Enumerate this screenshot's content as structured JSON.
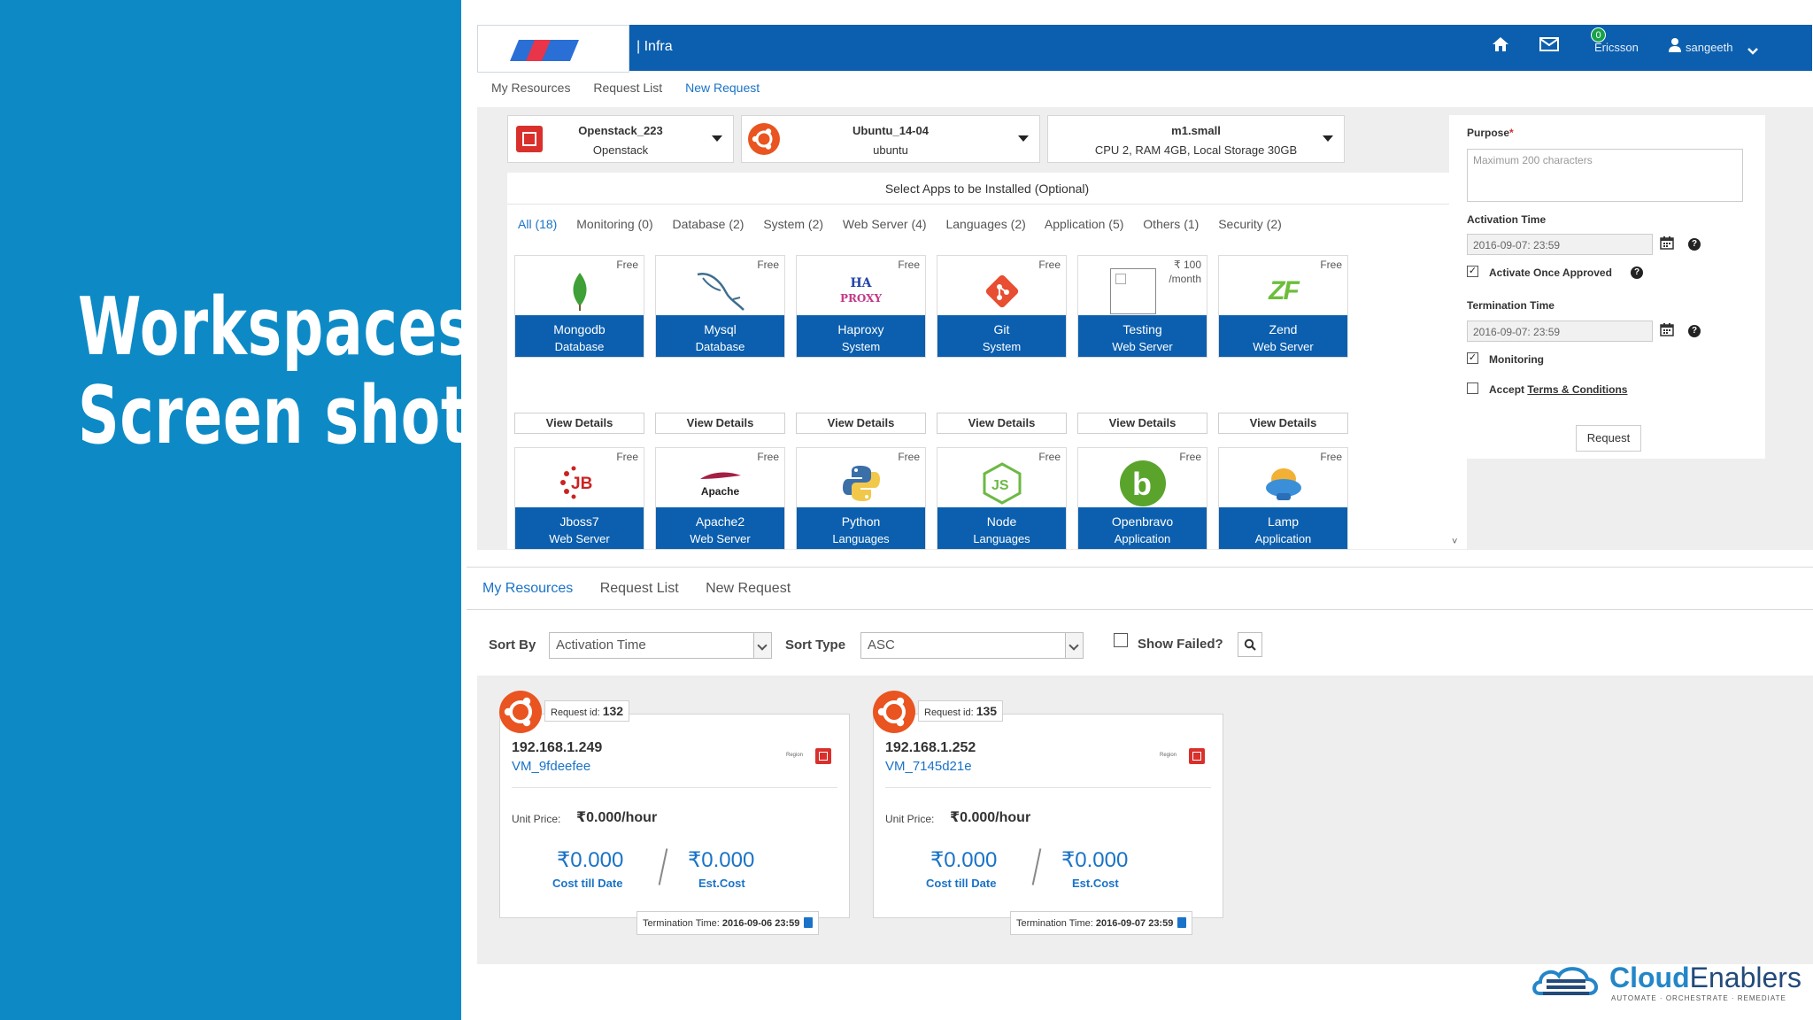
{
  "slide": {
    "title_line1": "Workspaces",
    "title_line2": "Screen shot"
  },
  "app_header": {
    "crumb": "| Infra",
    "mail_count": "0",
    "org": "Ericsson",
    "user": "sangeeth"
  },
  "subnav": [
    "My Resources",
    "Request List",
    "New Request"
  ],
  "selectors": [
    {
      "title": "Openstack_223",
      "sub": "Openstack"
    },
    {
      "title": "Ubuntu_14-04",
      "sub": "ubuntu"
    },
    {
      "title": "m1.small",
      "sub": "CPU 2, RAM 4GB, Local Storage 30GB"
    }
  ],
  "apps_header": "Select Apps to be Installed (Optional)",
  "filters": [
    "All (18)",
    "Monitoring (0)",
    "Database (2)",
    "System (2)",
    "Web Server (4)",
    "Languages (2)",
    "Application (5)",
    "Others (1)",
    "Security (2)"
  ],
  "apps": [
    {
      "name": "Mongodb",
      "cat": "Database",
      "price": "Free",
      "icon": "mongodb-leaf-icon"
    },
    {
      "name": "Mysql",
      "cat": "Database",
      "price": "Free",
      "icon": "mysql-dolphin-icon"
    },
    {
      "name": "Haproxy",
      "cat": "System",
      "price": "Free",
      "icon": "haproxy-logo-icon",
      "logo_text_1": "HA",
      "logo_text_2": "PROXY"
    },
    {
      "name": "Git",
      "cat": "System",
      "price": "Free",
      "icon": "git-logo-icon"
    },
    {
      "name": "Testing",
      "cat": "Web Server",
      "price": "₹ 100",
      "price2": "/month",
      "icon": "broken-image-icon"
    },
    {
      "name": "Zend",
      "cat": "Web Server",
      "price": "Free",
      "icon": "zend-logo-icon",
      "logo_text": "ZF"
    },
    {
      "name": "Jboss7",
      "cat": "Web Server",
      "price": "Free",
      "icon": "jboss-logo-icon",
      "logo_text": "JB"
    },
    {
      "name": "Apache2",
      "cat": "Web Server",
      "price": "Free",
      "icon": "apache-feather-icon",
      "logo_text": "Apache"
    },
    {
      "name": "Python",
      "cat": "Languages",
      "price": "Free",
      "icon": "python-logo-icon"
    },
    {
      "name": "Node",
      "cat": "Languages",
      "price": "Free",
      "icon": "nodejs-logo-icon",
      "logo_text": "JS"
    },
    {
      "name": "Openbravo",
      "cat": "Application",
      "price": "Free",
      "icon": "openbravo-logo-icon",
      "logo_text": "b"
    },
    {
      "name": "Lamp",
      "cat": "Application",
      "price": "Free",
      "icon": "lamp-logo-icon"
    }
  ],
  "view_details": "View Details",
  "request_form": {
    "purpose_label": "Purpose",
    "purpose_required": "*",
    "purpose_placeholder": "Maximum 200 characters",
    "activation_label": "Activation Time",
    "activation_value": "2016-09-07: 23:59",
    "activate_once": "Activate Once Approved",
    "activate_once_checked": true,
    "termination_label": "Termination Time",
    "termination_value": "2016-09-07: 23:59",
    "monitoring": "Monitoring",
    "monitoring_checked": true,
    "accept_prefix": "Accept ",
    "terms": "Terms & Conditions",
    "accept_checked": false,
    "request_btn": "Request"
  },
  "resources": {
    "tabs": [
      "My Resources",
      "Request List",
      "New Request"
    ],
    "sort_by_label": "Sort By",
    "sort_by_value": "Activation Time",
    "sort_type_label": "Sort Type",
    "sort_type_value": "ASC",
    "show_failed": "Show Failed?",
    "cards": [
      {
        "request_label": "Request id:",
        "request_id": "132",
        "ip": "192.168.1.249",
        "vm": "VM_9fdeefee",
        "region": "Region",
        "unit_label": "Unit Price:",
        "unit_price": "₹0.000/hour",
        "cost_till_date": "₹0.000",
        "cost_till_label": "Cost till Date",
        "est_cost": "₹0.000",
        "est_label": "Est.Cost",
        "term_label": "Termination Time:",
        "term_value": "2016-09-06 23:59"
      },
      {
        "request_label": "Request id:",
        "request_id": "135",
        "ip": "192.168.1.252",
        "vm": "VM_7145d21e",
        "region": "Region",
        "unit_label": "Unit Price:",
        "unit_price": "₹0.000/hour",
        "cost_till_date": "₹0.000",
        "cost_till_label": "Cost till Date",
        "est_cost": "₹0.000",
        "est_label": "Est.Cost",
        "term_label": "Termination Time:",
        "term_value": "2016-09-07 23:59"
      }
    ]
  },
  "brand": {
    "name_bold": "Cloud",
    "name_light": "Enablers",
    "tagline": "AUTOMATE · ORCHESTRATE · REMEDIATE"
  },
  "colors": {
    "slide_blue": "#0d8ac6",
    "app_blue": "#0b5fae",
    "link_blue": "#1a73c8",
    "ubuntu_orange": "#e95420"
  }
}
